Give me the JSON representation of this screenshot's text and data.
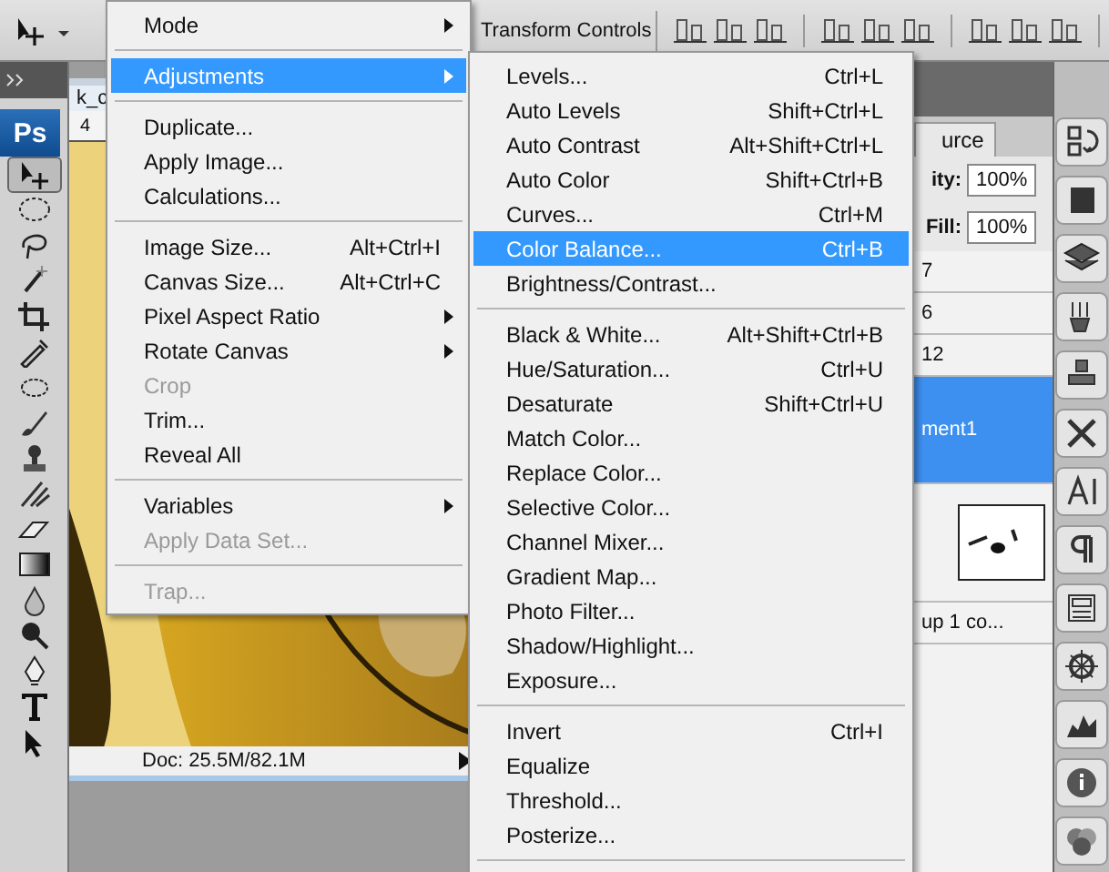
{
  "options_bar": {
    "transform_label": "Transform Controls"
  },
  "toolbox": {
    "logo": "Ps"
  },
  "document": {
    "tab_title": "k_c",
    "ruler_mark": "4",
    "status": "Doc: 25.5M/82.1M"
  },
  "layers_panel": {
    "tab": "urce",
    "opacity_label": "ity:",
    "opacity": "100%",
    "fill_label": "Fill:",
    "fill": "100%",
    "layers": [
      {
        "kind": "name",
        "name": "7",
        "selected": false
      },
      {
        "kind": "name",
        "name": "6",
        "selected": false
      },
      {
        "kind": "name",
        "name": "12",
        "selected": false
      },
      {
        "kind": "name",
        "name": "ment1",
        "selected": true
      },
      {
        "kind": "thumbnail",
        "selected": false
      },
      {
        "kind": "name",
        "name": "up 1 co...",
        "selected": false
      }
    ]
  },
  "image_menu": [
    {
      "kind": "item",
      "label": "Mode",
      "submenu": true,
      "selected": false,
      "disabled": false
    },
    {
      "kind": "separator"
    },
    {
      "kind": "item",
      "label": "Adjustments",
      "submenu": true,
      "selected": true,
      "disabled": false
    },
    {
      "kind": "separator"
    },
    {
      "kind": "item",
      "label": "Duplicate...",
      "selected": false,
      "disabled": false
    },
    {
      "kind": "item",
      "label": "Apply Image...",
      "selected": false,
      "disabled": false
    },
    {
      "kind": "item",
      "label": "Calculations...",
      "selected": false,
      "disabled": false
    },
    {
      "kind": "separator"
    },
    {
      "kind": "item",
      "label": "Image Size...",
      "shortcut": "Alt+Ctrl+I",
      "selected": false,
      "disabled": false
    },
    {
      "kind": "item",
      "label": "Canvas Size...",
      "shortcut": "Alt+Ctrl+C",
      "selected": false,
      "disabled": false
    },
    {
      "kind": "item",
      "label": "Pixel Aspect Ratio",
      "submenu": true,
      "selected": false,
      "disabled": false
    },
    {
      "kind": "item",
      "label": "Rotate Canvas",
      "submenu": true,
      "selected": false,
      "disabled": false
    },
    {
      "kind": "item",
      "label": "Crop",
      "selected": false,
      "disabled": true
    },
    {
      "kind": "item",
      "label": "Trim...",
      "selected": false,
      "disabled": false
    },
    {
      "kind": "item",
      "label": "Reveal All",
      "selected": false,
      "disabled": false
    },
    {
      "kind": "separator"
    },
    {
      "kind": "item",
      "label": "Variables",
      "submenu": true,
      "selected": false,
      "disabled": false
    },
    {
      "kind": "item",
      "label": "Apply Data Set...",
      "selected": false,
      "disabled": true
    },
    {
      "kind": "separator"
    },
    {
      "kind": "item",
      "label": "Trap...",
      "selected": false,
      "disabled": true
    }
  ],
  "adjustments_menu": [
    {
      "kind": "item",
      "label": "Levels...",
      "shortcut": "Ctrl+L",
      "selected": false,
      "disabled": false
    },
    {
      "kind": "item",
      "label": "Auto Levels",
      "shortcut": "Shift+Ctrl+L",
      "selected": false,
      "disabled": false
    },
    {
      "kind": "item",
      "label": "Auto Contrast",
      "shortcut": "Alt+Shift+Ctrl+L",
      "selected": false,
      "disabled": false
    },
    {
      "kind": "item",
      "label": "Auto Color",
      "shortcut": "Shift+Ctrl+B",
      "selected": false,
      "disabled": false
    },
    {
      "kind": "item",
      "label": "Curves...",
      "shortcut": "Ctrl+M",
      "selected": false,
      "disabled": false
    },
    {
      "kind": "item",
      "label": "Color Balance...",
      "shortcut": "Ctrl+B",
      "selected": true,
      "disabled": false
    },
    {
      "kind": "item",
      "label": "Brightness/Contrast...",
      "selected": false,
      "disabled": false
    },
    {
      "kind": "separator"
    },
    {
      "kind": "item",
      "label": "Black & White...",
      "shortcut": "Alt+Shift+Ctrl+B",
      "selected": false,
      "disabled": false
    },
    {
      "kind": "item",
      "label": "Hue/Saturation...",
      "shortcut": "Ctrl+U",
      "selected": false,
      "disabled": false
    },
    {
      "kind": "item",
      "label": "Desaturate",
      "shortcut": "Shift+Ctrl+U",
      "selected": false,
      "disabled": false
    },
    {
      "kind": "item",
      "label": "Match Color...",
      "selected": false,
      "disabled": false
    },
    {
      "kind": "item",
      "label": "Replace Color...",
      "selected": false,
      "disabled": false
    },
    {
      "kind": "item",
      "label": "Selective Color...",
      "selected": false,
      "disabled": false
    },
    {
      "kind": "item",
      "label": "Channel Mixer...",
      "selected": false,
      "disabled": false
    },
    {
      "kind": "item",
      "label": "Gradient Map...",
      "selected": false,
      "disabled": false
    },
    {
      "kind": "item",
      "label": "Photo Filter...",
      "selected": false,
      "disabled": false
    },
    {
      "kind": "item",
      "label": "Shadow/Highlight...",
      "selected": false,
      "disabled": false
    },
    {
      "kind": "item",
      "label": "Exposure...",
      "selected": false,
      "disabled": false
    },
    {
      "kind": "separator"
    },
    {
      "kind": "item",
      "label": "Invert",
      "shortcut": "Ctrl+I",
      "selected": false,
      "disabled": false
    },
    {
      "kind": "item",
      "label": "Equalize",
      "selected": false,
      "disabled": false
    },
    {
      "kind": "item",
      "label": "Threshold...",
      "selected": false,
      "disabled": false
    },
    {
      "kind": "item",
      "label": "Posterize...",
      "selected": false,
      "disabled": false
    },
    {
      "kind": "separator"
    }
  ]
}
